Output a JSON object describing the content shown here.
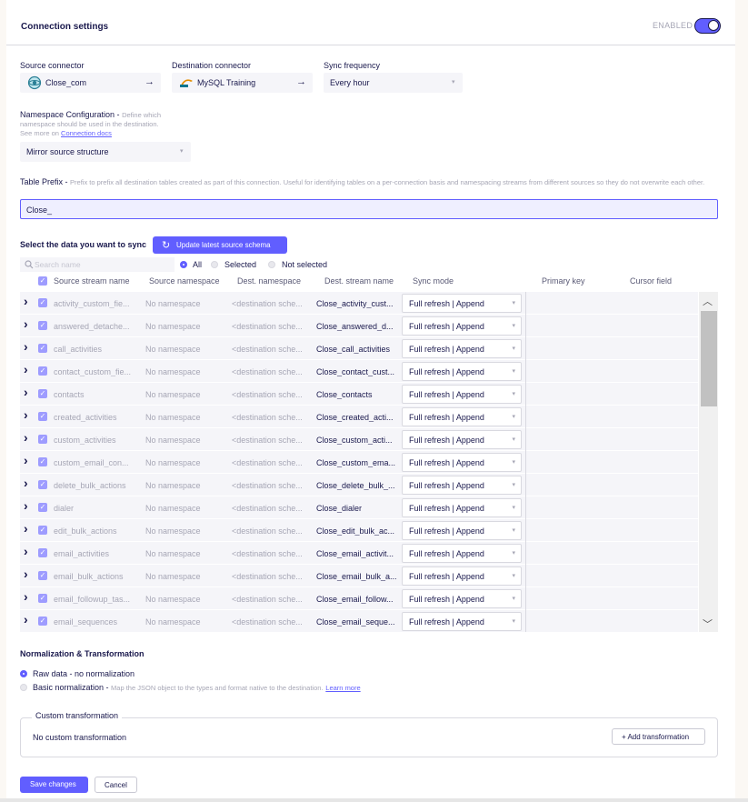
{
  "header": {
    "title": "Connection settings",
    "enabled_label": "ENABLED",
    "enabled": true
  },
  "source": {
    "label": "Source connector",
    "value": "Close_com"
  },
  "destination": {
    "label": "Destination connector",
    "value": "MySQL Training"
  },
  "frequency": {
    "label": "Sync frequency",
    "value": "Every hour"
  },
  "namespace": {
    "label": "Namespace Configuration - ",
    "hint": "Define which namespace should be used in the destination.",
    "hint_see": "See more on ",
    "hint_link": "Connection docs",
    "value": "Mirror source structure"
  },
  "prefix": {
    "label": "Table Prefix - ",
    "hint": "Prefix to prefix all destination tables created as part of this connection. Useful for identifying tables on a per-connection basis and namespacing streams from different sources so they do not overwrite each other.",
    "value": "Close_"
  },
  "sync": {
    "title": "Select the data you want to sync",
    "update_button": "Update latest source schema",
    "search_placeholder": "Search name",
    "filters": [
      "All",
      "Selected",
      "Not selected"
    ],
    "selected_filter": "All"
  },
  "columns": [
    "Source stream name",
    "Source namespace",
    "Dest. namespace",
    "Dest. stream name",
    "Sync mode",
    "Primary key",
    "Cursor field"
  ],
  "rows": [
    {
      "name": "activity_custom_fie...",
      "ns": "No namespace",
      "dns": "<destination sche...",
      "dsn": "Close_activity_cust...",
      "mode": "Full refresh | Append"
    },
    {
      "name": "answered_detache...",
      "ns": "No namespace",
      "dns": "<destination sche...",
      "dsn": "Close_answered_d...",
      "mode": "Full refresh | Append"
    },
    {
      "name": "call_activities",
      "ns": "No namespace",
      "dns": "<destination sche...",
      "dsn": "Close_call_activities",
      "mode": "Full refresh | Append"
    },
    {
      "name": "contact_custom_fie...",
      "ns": "No namespace",
      "dns": "<destination sche...",
      "dsn": "Close_contact_cust...",
      "mode": "Full refresh | Append"
    },
    {
      "name": "contacts",
      "ns": "No namespace",
      "dns": "<destination sche...",
      "dsn": "Close_contacts",
      "mode": "Full refresh | Append"
    },
    {
      "name": "created_activities",
      "ns": "No namespace",
      "dns": "<destination sche...",
      "dsn": "Close_created_acti...",
      "mode": "Full refresh | Append"
    },
    {
      "name": "custom_activities",
      "ns": "No namespace",
      "dns": "<destination sche...",
      "dsn": "Close_custom_acti...",
      "mode": "Full refresh | Append"
    },
    {
      "name": "custom_email_con...",
      "ns": "No namespace",
      "dns": "<destination sche...",
      "dsn": "Close_custom_ema...",
      "mode": "Full refresh | Append"
    },
    {
      "name": "delete_bulk_actions",
      "ns": "No namespace",
      "dns": "<destination sche...",
      "dsn": "Close_delete_bulk_...",
      "mode": "Full refresh | Append"
    },
    {
      "name": "dialer",
      "ns": "No namespace",
      "dns": "<destination sche...",
      "dsn": "Close_dialer",
      "mode": "Full refresh | Append"
    },
    {
      "name": "edit_bulk_actions",
      "ns": "No namespace",
      "dns": "<destination sche...",
      "dsn": "Close_edit_bulk_ac...",
      "mode": "Full refresh | Append"
    },
    {
      "name": "email_activities",
      "ns": "No namespace",
      "dns": "<destination sche...",
      "dsn": "Close_email_activit...",
      "mode": "Full refresh | Append"
    },
    {
      "name": "email_bulk_actions",
      "ns": "No namespace",
      "dns": "<destination sche...",
      "dsn": "Close_email_bulk_a...",
      "mode": "Full refresh | Append"
    },
    {
      "name": "email_followup_tas...",
      "ns": "No namespace",
      "dns": "<destination sche...",
      "dsn": "Close_email_follow...",
      "mode": "Full refresh | Append"
    },
    {
      "name": "email_sequences",
      "ns": "No namespace",
      "dns": "<destination sche...",
      "dsn": "Close_email_seque...",
      "mode": "Full refresh | Append"
    }
  ],
  "normalization": {
    "title": "Normalization & Transformation",
    "raw": "Raw data - no normalization",
    "basic": "Basic normalization - ",
    "basic_hint": "Map the JSON object to the types and format native to the destination.",
    "basic_link": "Learn more"
  },
  "custom": {
    "legend": "Custom transformation",
    "empty": "No custom transformation",
    "add_button": "+ Add transformation"
  },
  "actions": {
    "save": "Save changes",
    "cancel": "Cancel"
  },
  "colors": {
    "accent": "#615eff",
    "text": "#1a194d",
    "muted": "#a6a6b5"
  }
}
